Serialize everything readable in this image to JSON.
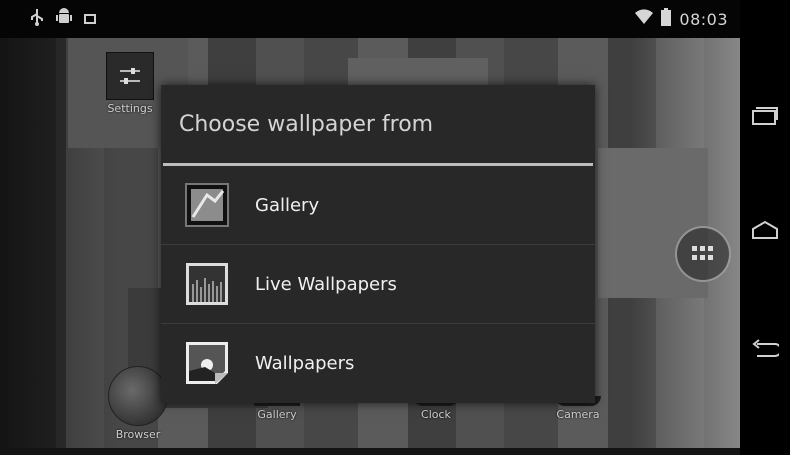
{
  "status_bar": {
    "time": "08:03",
    "left_icons": [
      "usb-icon",
      "android-debug-icon",
      "notification-icon"
    ],
    "right_icons": [
      "wifi-icon",
      "battery-icon"
    ]
  },
  "home": {
    "widget_label": "Settings",
    "dock_apps": [
      {
        "label": "Browser"
      },
      {
        "label": "Gallery"
      },
      {
        "label": "Clock"
      },
      {
        "label": "Camera"
      }
    ]
  },
  "dialog": {
    "title": "Choose wallpaper from",
    "items": [
      {
        "label": "Gallery",
        "icon": "gallery-icon"
      },
      {
        "label": "Live Wallpapers",
        "icon": "live-wallpapers-icon"
      },
      {
        "label": "Wallpapers",
        "icon": "wallpapers-icon"
      }
    ]
  },
  "nav_bar": {
    "buttons": [
      "recent-apps-icon",
      "home-icon",
      "back-icon"
    ]
  }
}
